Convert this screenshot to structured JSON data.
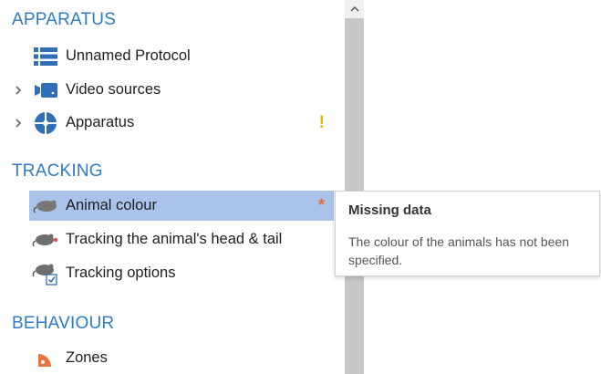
{
  "sections": {
    "apparatus": "APPARATUS",
    "tracking": "TRACKING",
    "behaviour": "BEHAVIOUR"
  },
  "items": {
    "unnamed_protocol": "Unnamed Protocol",
    "video_sources": "Video sources",
    "apparatus": "Apparatus",
    "animal_colour": "Animal colour",
    "head_tail": "Tracking the animal's head & tail",
    "tracking_options": "Tracking options",
    "zones": "Zones"
  },
  "badges": {
    "warning": "!",
    "required": "*"
  },
  "tooltip": {
    "title": "Missing data",
    "body": "The colour of the animals has not been specified."
  },
  "colors": {
    "section_heading": "#2e7bc6",
    "icon_blue": "#2f6fb5",
    "selected_row": "#a9c3ea",
    "warning": "#e6b800",
    "required": "#e0703c",
    "zone_orange": "#e8743b"
  },
  "icons": [
    "list-icon",
    "video-camera-icon",
    "apparatus-icon",
    "mouse-icon",
    "mouse-head-tail-icon",
    "mouse-options-icon",
    "zones-icon",
    "chevron-right-icon",
    "chevron-up-icon"
  ]
}
